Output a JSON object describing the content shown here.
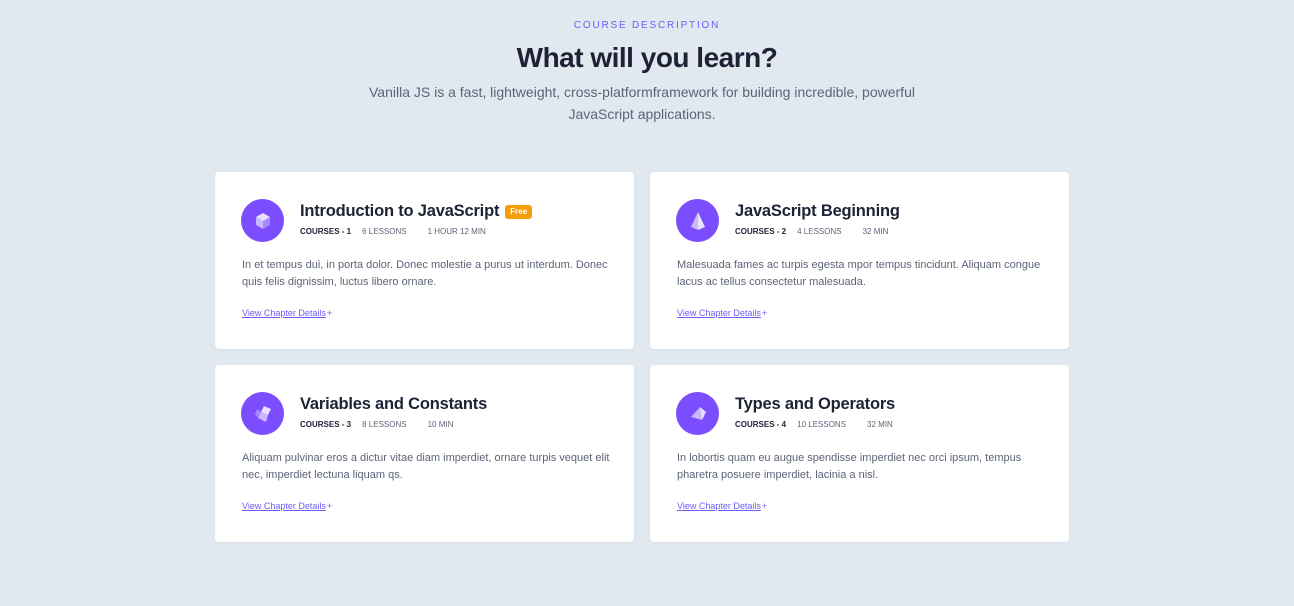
{
  "header": {
    "eyebrow": "COURSE DESCRIPTION",
    "title": "What will you learn?",
    "subtitle": "Vanilla JS is a fast, lightweight, cross-platformframework for building incredible, powerful JavaScript applications."
  },
  "colors": {
    "accent": "#6d5cf6",
    "icon_bg": "#7c4dff",
    "badge": "#f59e0b",
    "page_bg": "#e2e8f0"
  },
  "cards": [
    {
      "icon": "cube-icon",
      "title": "Introduction to JavaScript",
      "badge": "Free",
      "course": "COURSES - 1",
      "lessons": "6 LESSONS",
      "duration": "1 HOUR 12 MIN",
      "description": "In et tempus dui, in porta dolor. Donec molestie a purus ut interdum. Donec quis felis dignissim, luctus libero ornare.",
      "link": "View Chapter Details",
      "link_icon": "+"
    },
    {
      "icon": "pyramid-icon",
      "title": "JavaScript Beginning",
      "course": "COURSES - 2",
      "lessons": "4 LESSONS",
      "duration": "32 MIN",
      "description": "Malesuada fames ac turpis egesta mpor tempus tincidunt. Aliquam congue lacus ac tellus consectetur malesuada.",
      "link": "View Chapter Details",
      "link_icon": "+"
    },
    {
      "icon": "cube-icon",
      "title": "Variables and Constants",
      "course": "COURSES - 3",
      "lessons": "8 LESSONS",
      "duration": "10 MIN",
      "description": "Aliquam pulvinar eros a dictur vitae diam imperdiet, ornare turpis vequet elit nec, imperdiet lectuna liquam qs.",
      "link": "View Chapter Details",
      "link_icon": "+"
    },
    {
      "icon": "prism-icon",
      "title": "Types and Operators",
      "course": "COURSES - 4",
      "lessons": "10 LESSONS",
      "duration": "32 MIN",
      "description": "In lobortis quam eu augue spendisse imperdiet nec orci ipsum, tempus pharetra posuere imperdiet, lacinia a nisl.",
      "link": "View Chapter Details",
      "link_icon": "+"
    }
  ]
}
